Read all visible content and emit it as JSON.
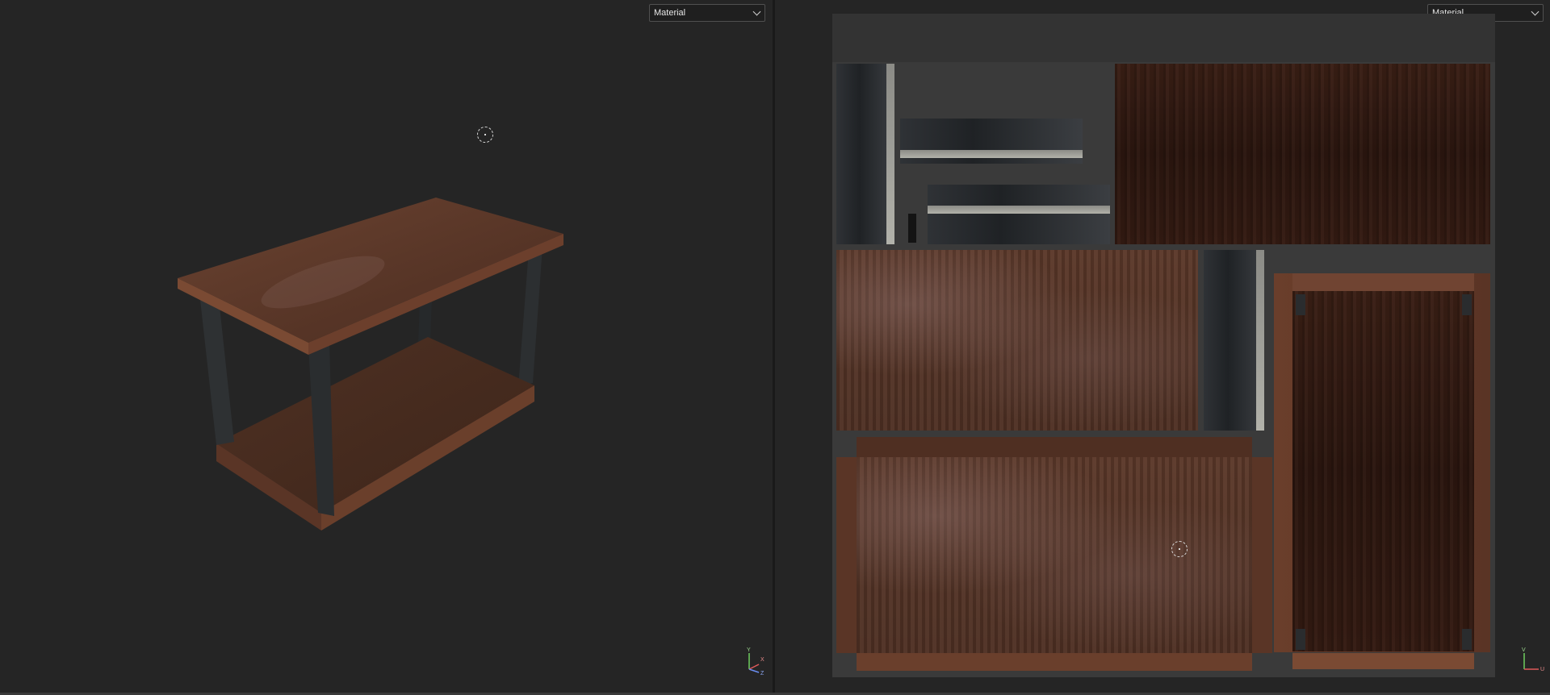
{
  "viewport_3d": {
    "shading_mode": "Material",
    "axis_labels": {
      "y": "Y",
      "x": "X",
      "z": "Z"
    }
  },
  "viewport_uv": {
    "shading_mode": "Material",
    "axis_labels": {
      "v": "V",
      "u": "U"
    }
  },
  "colors": {
    "background": "#252525",
    "wood": "#5b3829",
    "metal": "#2b2e31",
    "axis_x": "#e05a5a",
    "axis_y": "#6fcf5f",
    "axis_z": "#6a8df0"
  },
  "icons": [
    "chevron-down-icon",
    "pivot-icon",
    "axis-gizmo-icon"
  ]
}
